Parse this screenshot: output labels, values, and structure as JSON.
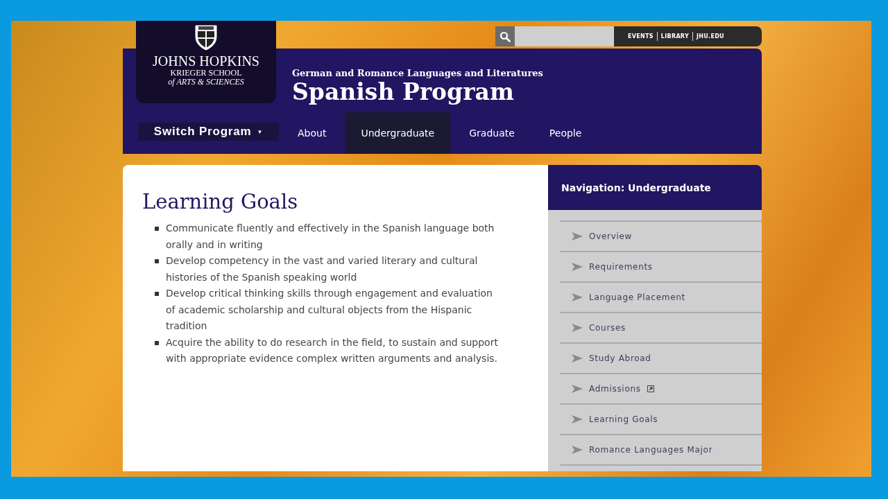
{
  "logo": {
    "line1": "JOHNS HOPKINS",
    "line2": "KRIEGER SCHOOL",
    "line3": "of ARTS & SCIENCES"
  },
  "utility_links": [
    "EVENTS",
    "LIBRARY",
    "JHU.EDU"
  ],
  "header": {
    "department": "German and Romance Languages and Literatures",
    "program": "Spanish Program"
  },
  "switch_program": {
    "label": "Switch Program",
    "caret": "▼"
  },
  "tabs": [
    {
      "label": "About",
      "selected": false
    },
    {
      "label": "Undergraduate",
      "selected": true
    },
    {
      "label": "Graduate",
      "selected": false
    },
    {
      "label": "People",
      "selected": false
    }
  ],
  "content": {
    "title": "Learning Goals",
    "goals": [
      "Communicate fluently and effectively in the Spanish language both orally and in writing",
      "Develop competency in the vast and varied literary and cultural histories of the Spanish speaking world",
      "Develop critical thinking skills through engagement and evaluation of academic scholarship and cultural objects from the Hispanic tradition",
      "Acquire the ability to do research in the field, to sustain and support with appropriate evidence complex written arguments and analysis."
    ]
  },
  "sidebar": {
    "title": "Navigation: Undergraduate",
    "items": [
      {
        "label": "Overview",
        "external": false
      },
      {
        "label": "Requirements",
        "external": false
      },
      {
        "label": "Language Placement",
        "external": false
      },
      {
        "label": "Courses",
        "external": false
      },
      {
        "label": "Study Abroad",
        "external": false
      },
      {
        "label": "Admissions",
        "external": true
      },
      {
        "label": "Learning Goals",
        "external": false
      },
      {
        "label": "Romance Languages Major",
        "external": false
      }
    ]
  }
}
